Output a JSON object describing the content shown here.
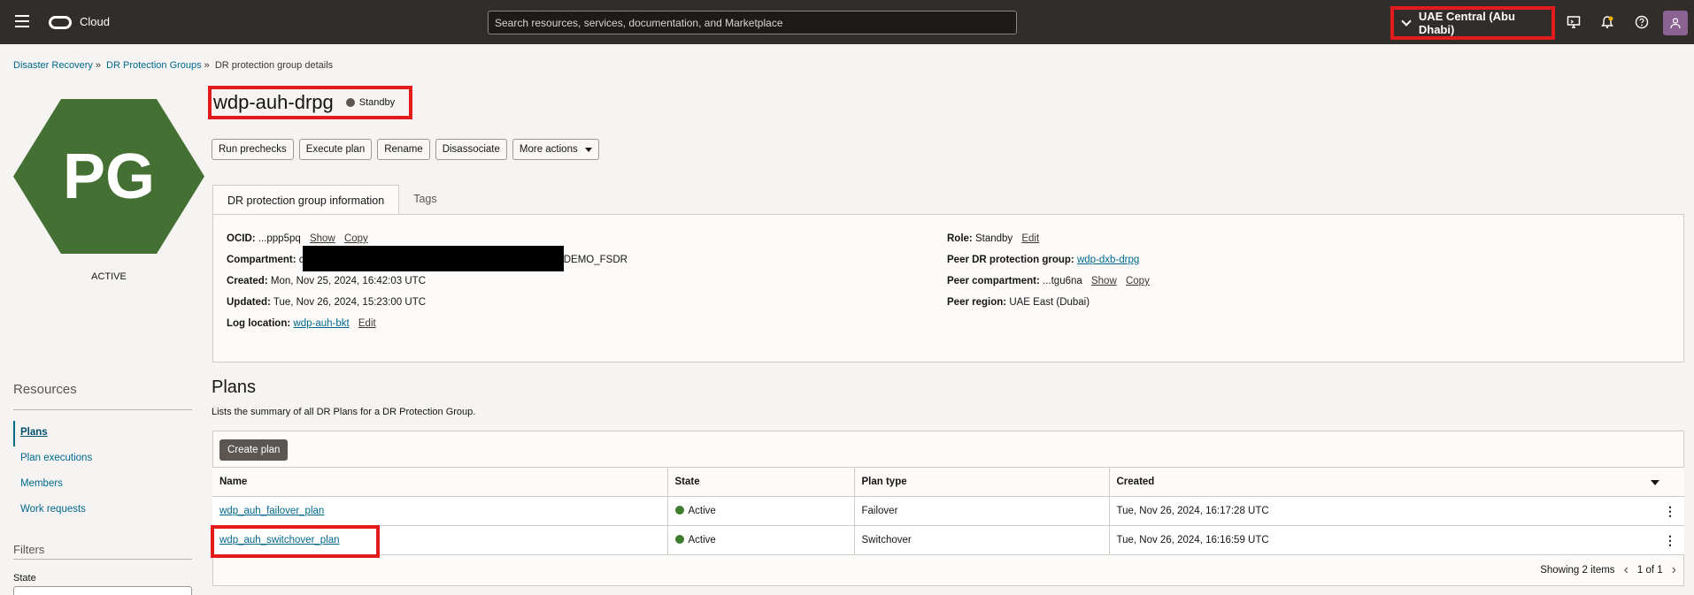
{
  "topbar": {
    "brand": "Cloud",
    "search_placeholder": "Search resources, services, documentation, and Marketplace",
    "region": "UAE Central (Abu Dhabi)",
    "icons": [
      "menu-icon",
      "oracle-logo-icon",
      "chevron-down-icon",
      "cloud-shell-icon",
      "bell-icon",
      "help-icon",
      "user-icon"
    ]
  },
  "breadcrumb": [
    "Disaster Recovery",
    "DR Protection Groups",
    "DR protection group details"
  ],
  "resource": {
    "initials": "PG",
    "lifecycle": "ACTIVE",
    "name": "wdp-auh-drpg",
    "role_badge": "Standby",
    "hex_color": "#457034"
  },
  "actions": [
    "Run prechecks",
    "Execute plan",
    "Rename",
    "Disassociate",
    "More actions"
  ],
  "tabs": [
    "DR protection group information",
    "Tags"
  ],
  "info": {
    "ocid_label": "OCID:",
    "ocid_value": "...ppp5pq",
    "show": "Show",
    "copy": "Copy",
    "compartment_label": "Compartment:",
    "compartment_prefix": "c",
    "compartment_suffix": "DEMO_FSDR",
    "created_label": "Created:",
    "created_value": "Mon, Nov 25, 2024, 16:42:03 UTC",
    "updated_label": "Updated:",
    "updated_value": "Tue, Nov 26, 2024, 15:23:00 UTC",
    "log_label": "Log location:",
    "log_value": "wdp-auh-bkt",
    "edit": "Edit",
    "role_label": "Role:",
    "role_value": "Standby",
    "peer_group_label": "Peer DR protection group:",
    "peer_group_value": "wdp-dxb-drpg",
    "peer_comp_label": "Peer compartment:",
    "peer_comp_value": "...tgu6na",
    "peer_region_label": "Peer region:",
    "peer_region_value": "UAE East (Dubai)"
  },
  "plans": {
    "heading": "Plans",
    "description": "Lists the summary of all DR Plans for a DR Protection Group.",
    "create_button": "Create plan",
    "columns": [
      "Name",
      "State",
      "Plan type",
      "Created"
    ],
    "rows": [
      {
        "name": "wdp_auh_failover_plan",
        "state": "Active",
        "type": "Failover",
        "created": "Tue, Nov 26, 2024, 16:17:28 UTC"
      },
      {
        "name": "wdp_auh_switchover_plan",
        "state": "Active",
        "type": "Switchover",
        "created": "Tue, Nov 26, 2024, 16:16:59 UTC"
      }
    ],
    "showing": "Showing 2 items",
    "page": "1 of 1"
  },
  "sidebar": {
    "resources_heading": "Resources",
    "items": [
      "Plans",
      "Plan executions",
      "Members",
      "Work requests"
    ],
    "filters_heading": "Filters",
    "state_label": "State"
  }
}
